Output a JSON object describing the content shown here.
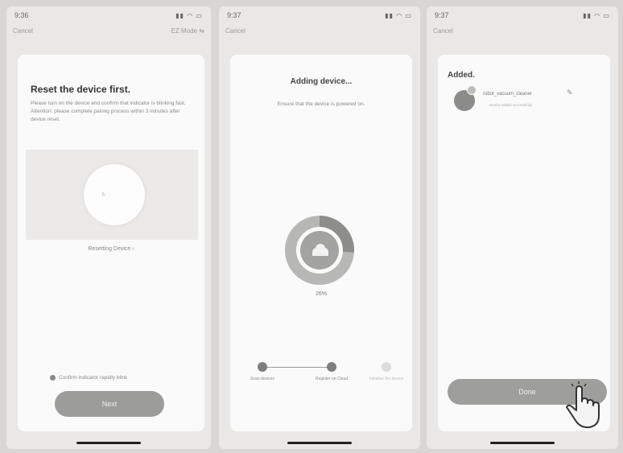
{
  "screen1": {
    "status_time": "9:36",
    "status_icons": "▮▮ ◠ ▭",
    "cancel": "Cancel",
    "mode": "EZ Mode ⇆",
    "title": "Reset the device first.",
    "body": "Please turn on the device and confirm that indicator is blinking fast. Attention: please complete pairing process within 3 minutes after device reset.",
    "device_hint": "↻ ◌",
    "reset_link": "Resetting Device ›",
    "confirm_label": "Confirm indicator rapidly blink",
    "next": "Next"
  },
  "screen2": {
    "status_time": "9:37",
    "status_icons": "▮▮ ◠ ▭",
    "cancel": "Cancel",
    "title": "Adding device...",
    "subtitle": "Ensure that the device is powered on.",
    "percent": "26%",
    "progress": 0.26,
    "steps": [
      {
        "label": "Scan devices",
        "state": "done"
      },
      {
        "label": "Register on Cloud",
        "state": "done"
      },
      {
        "label": "Initialize the device",
        "state": "pending"
      }
    ]
  },
  "screen3": {
    "status_time": "9:37",
    "status_icons": "▮▮ ◠ ▭",
    "cancel": "Cancel",
    "title": "Added.",
    "device_name": "robot_vacuum_cleaner",
    "device_sub": "Device added successfully",
    "done": "Done"
  },
  "colors": {
    "background": "#d9d6d3",
    "button": "#9c9c9a",
    "ring_outer": "#b7b7b5",
    "ring_progress": "#8d8d8b"
  }
}
